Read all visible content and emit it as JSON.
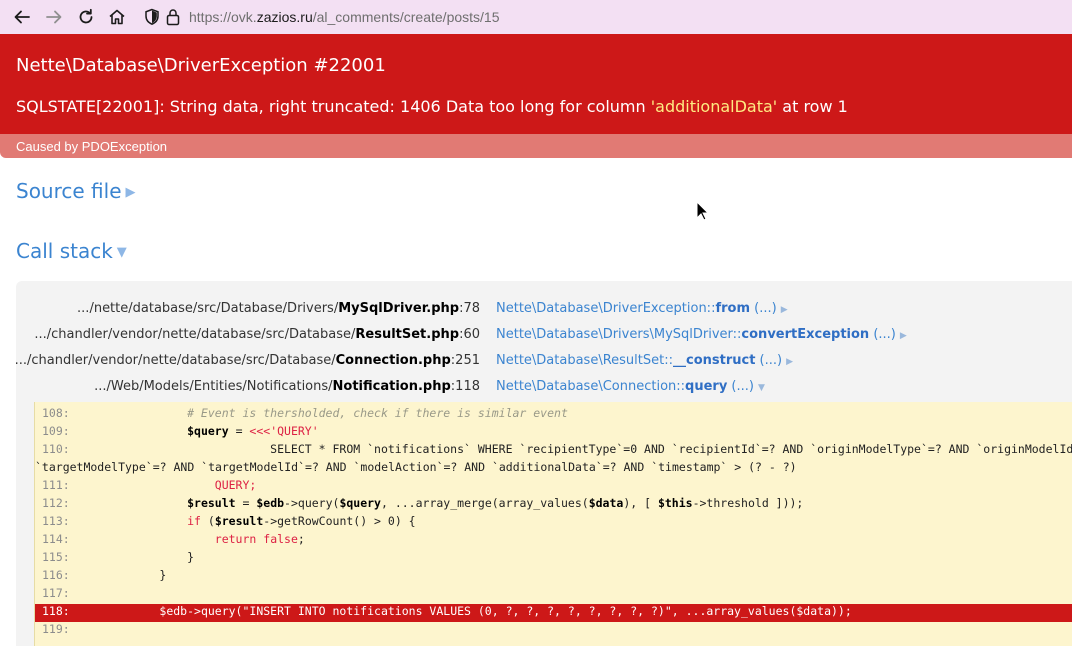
{
  "browser": {
    "url_prefix": "https://ovk.",
    "url_domain": "zazios.ru",
    "url_path": "/al_comments/create/posts/15"
  },
  "error": {
    "title": "Nette\\Database\\DriverException #22001",
    "message_before": "SQLSTATE[22001]: String data, right truncated: 1406 Data too long for column ",
    "message_highlight": "'additionalData'",
    "message_after": " at row 1",
    "caused_by": "Caused by PDOException"
  },
  "sections": {
    "source_file": "Source file",
    "call_stack": "Call stack"
  },
  "call_stack": [
    {
      "path": ".../nette/database/src/Database/Drivers/",
      "file": "MySqlDriver.php",
      "line": ":78",
      "class": "Nette\\Database\\DriverException::",
      "method": "from",
      "args": " (...)"
    },
    {
      "path": ".../chandler/vendor/nette/database/src/Database/",
      "file": "ResultSet.php",
      "line": ":60",
      "class": "Nette\\Database\\Drivers\\MySqlDriver::",
      "method": "convertException",
      "args": " (...)"
    },
    {
      "path": ".../chandler/vendor/nette/database/src/Database/",
      "file": "Connection.php",
      "line": ":251",
      "class": "Nette\\Database\\ResultSet::",
      "method": "__construct",
      "args": " (...)"
    },
    {
      "path": ".../Web/Models/Entities/Notifications/",
      "file": "Notification.php",
      "line": ":118",
      "class": "Nette\\Database\\Connection::",
      "method": "query",
      "args": " (...)"
    }
  ],
  "code": [
    {
      "n": "108:",
      "t": "            # Event is thersholded, check if there is similar event"
    },
    {
      "n": "109:",
      "t": "            $query = <<<'QUERY'"
    },
    {
      "n": "110:",
      "t": "                        SELECT * FROM `notifications` WHERE `recipientType`=0 AND `recipientId`=? AND `originModelType`=? AND `originModelId`=? AND"
    },
    {
      "n": "",
      "t": "`targetModelType`=? AND `targetModelId`=? AND `modelAction`=? AND `additionalData`=? AND `timestamp` > (? - ?)"
    },
    {
      "n": "111:",
      "t": "                QUERY;"
    },
    {
      "n": "112:",
      "t": "            $result = $edb->query($query, ...array_merge(array_values($data), [ $this->threshold ]));"
    },
    {
      "n": "113:",
      "t": "            if ($result->getRowCount() > 0) {"
    },
    {
      "n": "114:",
      "t": "                return false;"
    },
    {
      "n": "115:",
      "t": "            }"
    },
    {
      "n": "116:",
      "t": "        }"
    },
    {
      "n": "117:",
      "t": ""
    },
    {
      "n": "118:",
      "t": "        $edb->query(\"INSERT INTO notifications VALUES (0, ?, ?, ?, ?, ?, ?, ?, ?)\", ...array_values($data));"
    },
    {
      "n": "119:",
      "t": ""
    }
  ],
  "active_line": "118:",
  "colors": {
    "error_red": "#cd1818",
    "caused_bar": "#e17a74",
    "link_blue": "#3b84d0",
    "code_bg": "#fdf5ce"
  }
}
